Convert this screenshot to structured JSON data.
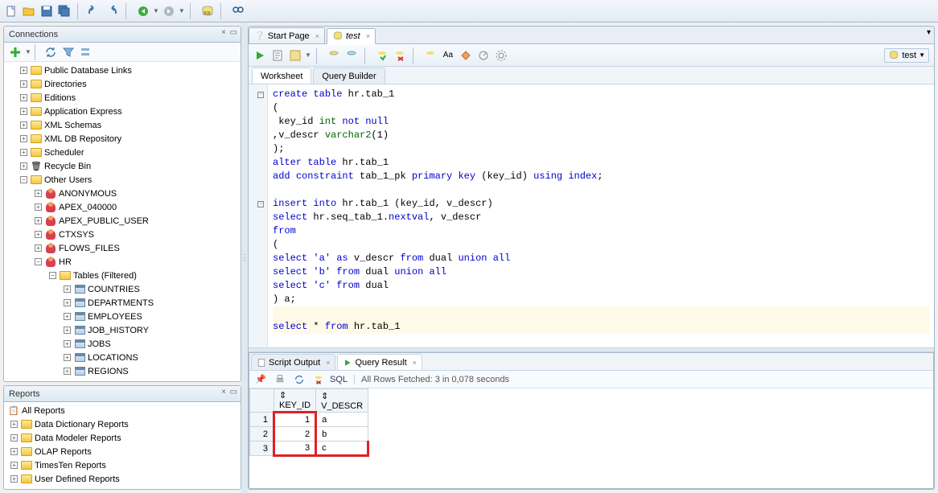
{
  "connections": {
    "title": "Connections",
    "tree": {
      "pubdblinks": "Public Database Links",
      "directories": "Directories",
      "editions": "Editions",
      "appexpress": "Application Express",
      "xmlschemas": "XML Schemas",
      "xmldb": "XML DB Repository",
      "scheduler": "Scheduler",
      "recyclebin": "Recycle Bin",
      "otherusers": "Other Users",
      "anonymous": "ANONYMOUS",
      "apex040000": "APEX_040000",
      "apexpublic": "APEX_PUBLIC_USER",
      "ctxsys": "CTXSYS",
      "flowsfiles": "FLOWS_FILES",
      "hr": "HR",
      "tablesfiltered": "Tables (Filtered)",
      "countries": "COUNTRIES",
      "departments": "DEPARTMENTS",
      "employees": "EMPLOYEES",
      "jobhistory": "JOB_HISTORY",
      "jobs": "JOBS",
      "locations": "LOCATIONS",
      "regions": "REGIONS"
    }
  },
  "reports": {
    "title": "Reports",
    "items": {
      "all": "All Reports",
      "datadict": "Data Dictionary Reports",
      "datamodeler": "Data Modeler Reports",
      "olap": "OLAP Reports",
      "timesten": "TimesTen Reports",
      "userdef": "User Defined Reports"
    }
  },
  "tabs": {
    "startpage": "Start Page",
    "test": "test"
  },
  "subtabs": {
    "worksheet": "Worksheet",
    "querybuilder": "Query Builder"
  },
  "dbselector": "test",
  "code": {
    "l1": "create table hr.tab_1",
    "l2": "(",
    "l3": " key_id int not null",
    "l4": ",v_descr varchar2(1)",
    "l5": ");",
    "l6": "alter table hr.tab_1",
    "l7": "add constraint tab_1_pk primary key (key_id) using index;",
    "l8": "",
    "l9": "insert into hr.tab_1 (key_id, v_descr)",
    "l10": "select hr.seq_tab_1.nextval, v_descr",
    "l11": "from",
    "l12": "(",
    "l13": "select 'a' as v_descr from dual union all",
    "l14": "select 'b' from dual union all",
    "l15": "select 'c' from dual",
    "l16": ") a;",
    "l17": "",
    "l18": "select * from hr.tab_1"
  },
  "output": {
    "scriptoutput": "Script Output",
    "queryresult": "Query Result",
    "sqlbtn": "SQL",
    "status": "All Rows Fetched: 3 in 0,078 seconds",
    "cols": {
      "c1": "KEY_ID",
      "c2": "V_DESCR"
    },
    "rows": [
      {
        "n": "1",
        "k": "1",
        "v": "a"
      },
      {
        "n": "2",
        "k": "2",
        "v": "b"
      },
      {
        "n": "3",
        "k": "3",
        "v": "c"
      }
    ]
  }
}
